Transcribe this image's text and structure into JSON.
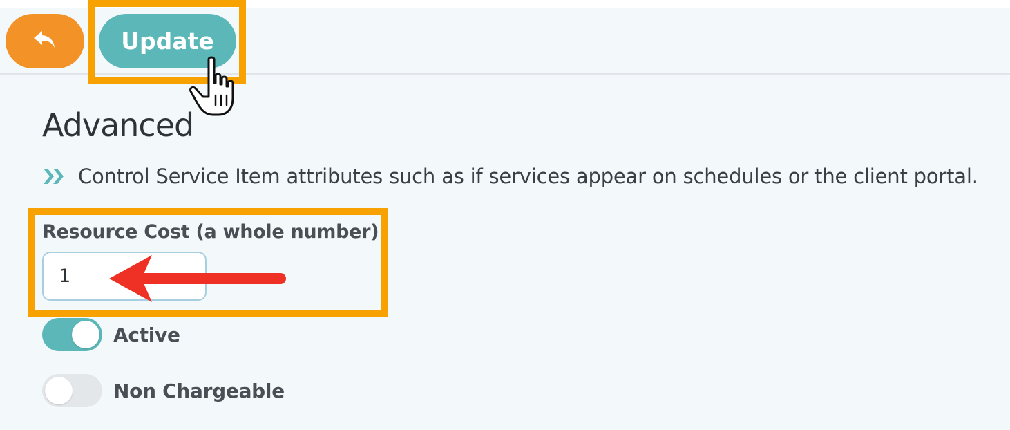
{
  "toolbar": {
    "back_icon": "undo-arrow-icon",
    "update_label": "Update"
  },
  "section": {
    "title": "Advanced",
    "description_icon": "double-chevron-right-icon",
    "description": "Control Service Item attributes such as if services appear on schedules or the client portal."
  },
  "resource_cost": {
    "label": "Resource Cost (a whole number)",
    "value": "1"
  },
  "toggles": [
    {
      "label": "Active",
      "checked": true
    },
    {
      "label": "Non Chargeable",
      "checked": false
    }
  ],
  "annotations": {
    "highlight_color": "#f7a200",
    "arrow_color": "#ee3124",
    "cursor_icon": "pointer-hand-icon"
  },
  "colors": {
    "back_button": "#f39226",
    "accent_teal": "#5cb8b8"
  }
}
